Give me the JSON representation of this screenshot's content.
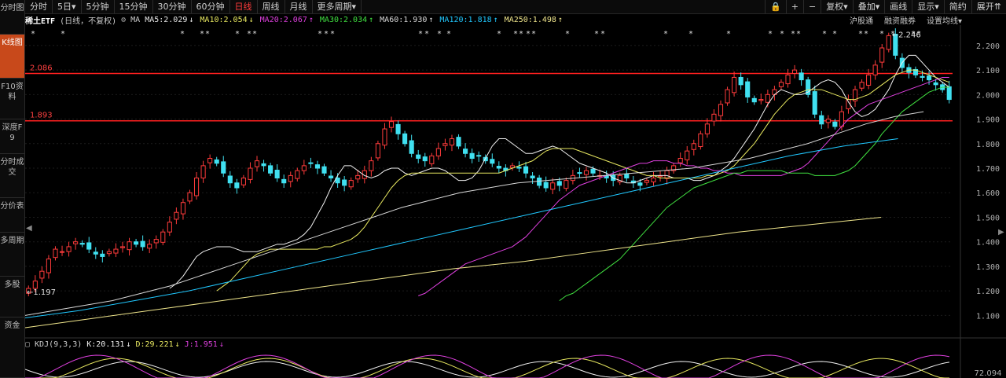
{
  "topbar": {
    "periods": [
      "分时",
      "5日▾",
      "5分钟",
      "15分钟",
      "30分钟",
      "60分钟",
      "日线",
      "周线",
      "月线",
      "更多周期▾"
    ],
    "active_period": "日线",
    "right_items": [
      "🔒",
      "+",
      "−",
      "复权▾",
      "叠加▾",
      "画线",
      "显示▾",
      "简约",
      "展开⇈"
    ]
  },
  "sidebar": {
    "items": [
      "分时图",
      "K线图",
      "F10资料",
      "深度F9",
      "分时成交",
      "分价表",
      "多周期",
      "多股",
      "资金"
    ],
    "active": "K线图"
  },
  "ma_line": {
    "name": "稀土ETF",
    "mode": "(日线，不复权)",
    "icon": "⚙",
    "ma_label": "MA",
    "items": [
      {
        "text": "MA5:2.029",
        "arrow": "↓",
        "color": "#e8e8e8"
      },
      {
        "text": "MA10:2.054",
        "arrow": "↓",
        "color": "#e8e860"
      },
      {
        "text": "MA20:2.067",
        "arrow": "↑",
        "color": "#e040e0"
      },
      {
        "text": "MA30:2.034",
        "arrow": "↑",
        "color": "#40e040"
      },
      {
        "text": "MA60:1.930",
        "arrow": "↑",
        "color": "#d8d8d8"
      },
      {
        "text": "MA120:1.818",
        "arrow": "↑",
        "color": "#20c8ff"
      },
      {
        "text": "MA250:1.498",
        "arrow": "↑",
        "color": "#f0e68c"
      }
    ]
  },
  "right_links": [
    "沪股通",
    "融资融券",
    "设置均线▾"
  ],
  "kdj": {
    "label": "KDJ(9,3,3)",
    "k": "K:20.131",
    "k_arrow": "↓",
    "d": "D:29.221",
    "d_arrow": "↓",
    "j": "J:1.951",
    "j_arrow": "↓",
    "axis_value": "72.094"
  },
  "chart_data": {
    "type": "candlestick",
    "ylim": [
      1.05,
      2.27
    ],
    "y_ticks": [
      "2.200",
      "2.100",
      "2.000",
      "1.900",
      "1.800",
      "1.700",
      "1.600",
      "1.500",
      "1.400",
      "1.300",
      "1.200",
      "1.100"
    ],
    "hlines": [
      {
        "label": "2.086",
        "value": 2.086
      },
      {
        "label": "1.893",
        "value": 1.893
      }
    ],
    "annotations": [
      {
        "text": "←1.197",
        "value": 1.197,
        "position": "start"
      },
      {
        "text": "←2.246",
        "value": 2.246,
        "position": "peak"
      }
    ],
    "up_color": "#ff3b3b",
    "down_color": "#40e0f0",
    "closes": [
      1.21,
      1.24,
      1.28,
      1.33,
      1.37,
      1.36,
      1.38,
      1.4,
      1.39,
      1.37,
      1.35,
      1.34,
      1.36,
      1.37,
      1.38,
      1.4,
      1.39,
      1.38,
      1.39,
      1.41,
      1.44,
      1.48,
      1.52,
      1.56,
      1.6,
      1.66,
      1.71,
      1.74,
      1.72,
      1.68,
      1.64,
      1.62,
      1.66,
      1.7,
      1.73,
      1.71,
      1.68,
      1.66,
      1.64,
      1.67,
      1.69,
      1.71,
      1.72,
      1.7,
      1.68,
      1.66,
      1.64,
      1.63,
      1.65,
      1.67,
      1.69,
      1.73,
      1.8,
      1.86,
      1.89,
      1.84,
      1.8,
      1.76,
      1.74,
      1.73,
      1.75,
      1.78,
      1.8,
      1.82,
      1.79,
      1.76,
      1.74,
      1.75,
      1.73,
      1.72,
      1.7,
      1.69,
      1.71,
      1.7,
      1.68,
      1.66,
      1.63,
      1.62,
      1.64,
      1.63,
      1.65,
      1.67,
      1.68,
      1.69,
      1.68,
      1.67,
      1.66,
      1.65,
      1.67,
      1.66,
      1.64,
      1.63,
      1.65,
      1.66,
      1.67,
      1.69,
      1.71,
      1.74,
      1.77,
      1.8,
      1.84,
      1.88,
      1.92,
      1.96,
      2.02,
      2.07,
      2.04,
      1.99,
      1.97,
      1.98,
      2.0,
      2.02,
      2.05,
      2.08,
      2.1,
      2.06,
      2.0,
      1.92,
      1.88,
      1.9,
      1.87,
      1.93,
      1.98,
      2.02,
      2.05,
      2.08,
      2.12,
      2.19,
      2.24,
      2.16,
      2.11,
      2.09,
      2.08,
      2.07,
      2.06,
      2.04,
      2.02,
      1.98
    ],
    "ma_series": [
      {
        "name": "MA5",
        "values": [
          1.21,
          1.23,
          1.26,
          1.3,
          1.34,
          1.36,
          1.37,
          1.38,
          1.38,
          1.38,
          1.37,
          1.36,
          1.36,
          1.36,
          1.37,
          1.38,
          1.39,
          1.39,
          1.4,
          1.41,
          1.43,
          1.46,
          1.51,
          1.56,
          1.62,
          1.67,
          1.71,
          1.71,
          1.69,
          1.67,
          1.66,
          1.67,
          1.69,
          1.7,
          1.7,
          1.68,
          1.67,
          1.68,
          1.69,
          1.7,
          1.7,
          1.69,
          1.67,
          1.65,
          1.65,
          1.66,
          1.69,
          1.74,
          1.79,
          1.82,
          1.82,
          1.8,
          1.78,
          1.76,
          1.76,
          1.77,
          1.78,
          1.79,
          1.78,
          1.76,
          1.74,
          1.72,
          1.71,
          1.7,
          1.69,
          1.68,
          1.66,
          1.65,
          1.64,
          1.64,
          1.65,
          1.66,
          1.67,
          1.67,
          1.67,
          1.66,
          1.66,
          1.66,
          1.65,
          1.65,
          1.66,
          1.67,
          1.69,
          1.71,
          1.74,
          1.78,
          1.82,
          1.86,
          1.91,
          1.96,
          2.0,
          2.02,
          2.01,
          2.0,
          2.0,
          2.01,
          2.03,
          2.05,
          2.06,
          2.05,
          2.02,
          1.97,
          1.93,
          1.91,
          1.92,
          1.94,
          1.98,
          2.02,
          2.08,
          2.13,
          2.16,
          2.16,
          2.13,
          2.1,
          2.07,
          2.05,
          2.03
        ]
      },
      {
        "name": "MA10",
        "values": [
          1.2,
          1.22,
          1.24,
          1.27,
          1.3,
          1.33,
          1.35,
          1.36,
          1.37,
          1.37,
          1.37,
          1.37,
          1.37,
          1.37,
          1.37,
          1.37,
          1.38,
          1.38,
          1.39,
          1.4,
          1.41,
          1.43,
          1.46,
          1.5,
          1.54,
          1.58,
          1.62,
          1.65,
          1.67,
          1.68,
          1.68,
          1.68,
          1.68,
          1.68,
          1.68,
          1.68,
          1.68,
          1.68,
          1.68,
          1.68,
          1.68,
          1.68,
          1.68,
          1.69,
          1.7,
          1.71,
          1.72,
          1.73,
          1.75,
          1.77,
          1.78,
          1.78,
          1.78,
          1.78,
          1.77,
          1.76,
          1.75,
          1.74,
          1.73,
          1.72,
          1.71,
          1.7,
          1.69,
          1.68,
          1.67,
          1.67,
          1.66,
          1.66,
          1.66,
          1.66,
          1.66,
          1.66,
          1.66,
          1.67,
          1.67,
          1.68,
          1.69,
          1.71,
          1.74,
          1.77,
          1.8,
          1.84,
          1.88,
          1.92,
          1.95,
          1.98,
          2.0,
          2.01,
          2.02,
          2.02,
          2.02,
          2.01,
          2.0,
          1.99,
          1.98,
          1.98,
          1.99,
          2.0,
          2.02,
          2.04,
          2.06,
          2.08,
          2.09,
          2.1,
          2.1,
          2.09,
          2.08,
          2.07,
          2.06,
          2.05
        ]
      },
      {
        "name": "MA20",
        "values": [
          1.18,
          1.19,
          1.21,
          1.23,
          1.25,
          1.27,
          1.29,
          1.31,
          1.32,
          1.33,
          1.34,
          1.35,
          1.36,
          1.37,
          1.38,
          1.4,
          1.42,
          1.45,
          1.48,
          1.51,
          1.54,
          1.57,
          1.59,
          1.61,
          1.63,
          1.64,
          1.65,
          1.66,
          1.67,
          1.68,
          1.69,
          1.7,
          1.71,
          1.72,
          1.72,
          1.73,
          1.73,
          1.73,
          1.72,
          1.72,
          1.71,
          1.71,
          1.7,
          1.7,
          1.69,
          1.69,
          1.68,
          1.68,
          1.67,
          1.67,
          1.67,
          1.67,
          1.67,
          1.67,
          1.67,
          1.68,
          1.69,
          1.7,
          1.72,
          1.75,
          1.78,
          1.81,
          1.84,
          1.87,
          1.9,
          1.92,
          1.94,
          1.96,
          1.97,
          1.98,
          1.99,
          2.0,
          2.01,
          2.02,
          2.03,
          2.04,
          2.05,
          2.06,
          2.07,
          2.07
        ]
      },
      {
        "name": "MA30",
        "values": [
          1.16,
          1.18,
          1.19,
          1.21,
          1.23,
          1.25,
          1.27,
          1.29,
          1.31,
          1.33,
          1.36,
          1.39,
          1.42,
          1.45,
          1.48,
          1.51,
          1.54,
          1.56,
          1.58,
          1.6,
          1.62,
          1.63,
          1.64,
          1.65,
          1.66,
          1.67,
          1.68,
          1.68,
          1.69,
          1.69,
          1.69,
          1.69,
          1.69,
          1.69,
          1.68,
          1.68,
          1.68,
          1.68,
          1.67,
          1.67,
          1.67,
          1.67,
          1.68,
          1.69,
          1.71,
          1.74,
          1.77,
          1.8,
          1.84,
          1.87,
          1.9,
          1.93,
          1.95,
          1.97,
          1.99,
          2.01,
          2.02,
          2.03,
          2.03
        ]
      },
      {
        "name": "MA60",
        "values": [
          1.1,
          1.12,
          1.14,
          1.16,
          1.19,
          1.22,
          1.26,
          1.3,
          1.34,
          1.38,
          1.42,
          1.46,
          1.5,
          1.54,
          1.57,
          1.6,
          1.62,
          1.64,
          1.65,
          1.66,
          1.67,
          1.68,
          1.69,
          1.7,
          1.72,
          1.74,
          1.77,
          1.8,
          1.84,
          1.88,
          1.91,
          1.93
        ]
      },
      {
        "name": "MA120",
        "values": [
          1.09,
          1.12,
          1.16,
          1.2,
          1.25,
          1.3,
          1.35,
          1.4,
          1.45,
          1.5,
          1.55,
          1.6,
          1.65,
          1.7,
          1.75,
          1.79,
          1.82
        ]
      },
      {
        "name": "MA250",
        "values": [
          1.05,
          1.09,
          1.13,
          1.17,
          1.21,
          1.25,
          1.29,
          1.32,
          1.36,
          1.4,
          1.44,
          1.47,
          1.5
        ]
      }
    ],
    "ma_colors": [
      "#f0f0f0",
      "#e8e860",
      "#e040e0",
      "#40e040",
      "#d8d8d8",
      "#20c8ff",
      "#f0e68c"
    ],
    "kdj_series": [
      {
        "name": "K",
        "color": "#f0f0f0"
      },
      {
        "name": "D",
        "color": "#e8e860"
      },
      {
        "name": "J",
        "color": "#e040e0"
      }
    ]
  }
}
